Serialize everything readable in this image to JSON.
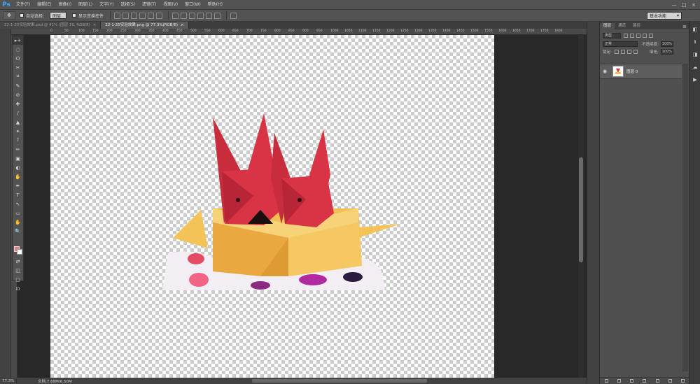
{
  "app": {
    "logo": "Ps"
  },
  "menu": [
    "文件(F)",
    "编辑(E)",
    "图像(I)",
    "图层(L)",
    "文字(Y)",
    "选择(S)",
    "滤镜(T)",
    "视图(V)",
    "窗口(W)",
    "帮助(H)"
  ],
  "window_controls": [
    "—",
    "□",
    "×"
  ],
  "options_bar": {
    "tool_icon": "move-tool-icon",
    "auto_select_label": "自动选择：",
    "auto_select_value": "图层",
    "show_transform_label": "显示变换控件",
    "workspace": "基本功能"
  },
  "tabs": [
    {
      "label": "22-1-25实验效果.psd @ 41% (图层 16, RGB/8)",
      "close": "×",
      "active": false
    },
    {
      "label": "22-1-25实验效果.png @ 77.3%(RGB/8)",
      "close": "×",
      "active": true
    }
  ],
  "ruler_ticks": [
    "0",
    "50",
    "100",
    "150",
    "200",
    "250",
    "300",
    "350",
    "400",
    "450",
    "500",
    "550",
    "600",
    "650",
    "700",
    "750",
    "800",
    "850",
    "900",
    "950",
    "1000",
    "1050",
    "1100",
    "1150",
    "1200",
    "1250",
    "1300",
    "1350",
    "1400",
    "1450",
    "1500",
    "1550",
    "1600",
    "1650",
    "1700",
    "1750",
    "1800"
  ],
  "tools": [
    "▸+",
    "◌",
    "ⵔ",
    "✂",
    "⌗",
    "✎",
    "⊘",
    "✚",
    "/",
    "▲",
    "✦",
    "⟟",
    "✏",
    "▣",
    "◐",
    "✋",
    "✒",
    "T",
    "↖",
    "▭",
    "✋",
    "🔍",
    "⇄",
    "◫",
    "▢",
    "⊡"
  ],
  "colors": {
    "foreground": "#f07b86",
    "background": "#ffffff"
  },
  "status": {
    "zoom": "77.3%",
    "doc": "文档:7.68M/6.50M"
  },
  "layers_panel": {
    "tabs": [
      "图层",
      "通道",
      "路径"
    ],
    "menu_icon": "≡",
    "kind_filter": "类型",
    "blend_mode": "正常",
    "opacity_label": "不透明度:",
    "opacity_value": "100%",
    "lock_label": "锁定:",
    "fill_label": "填充:",
    "fill_value": "100%",
    "layers": [
      {
        "name": "图层 0",
        "visible": true
      }
    ]
  },
  "dock_icons": [
    "◧",
    "ℹ",
    "◨",
    "☁",
    "▶"
  ]
}
